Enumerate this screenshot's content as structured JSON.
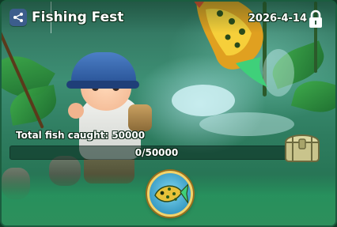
{
  "header": {
    "title": "Fishing Fest",
    "date": "2026-4-14",
    "share_icon": "share-icon",
    "lock_icon": "lock-icon"
  },
  "progress": {
    "caught_label": "Total fish caught: 50000",
    "progress_text": "0/50000",
    "current": 0,
    "target": 50000
  },
  "reward": {
    "chest_icon": "treasure-chest-icon",
    "badge_icon": "fish-badge-icon"
  },
  "colors": {
    "accent_green": "#2e8f5c",
    "gold_border": "#f4d36a",
    "header_text": "#ffffff"
  }
}
